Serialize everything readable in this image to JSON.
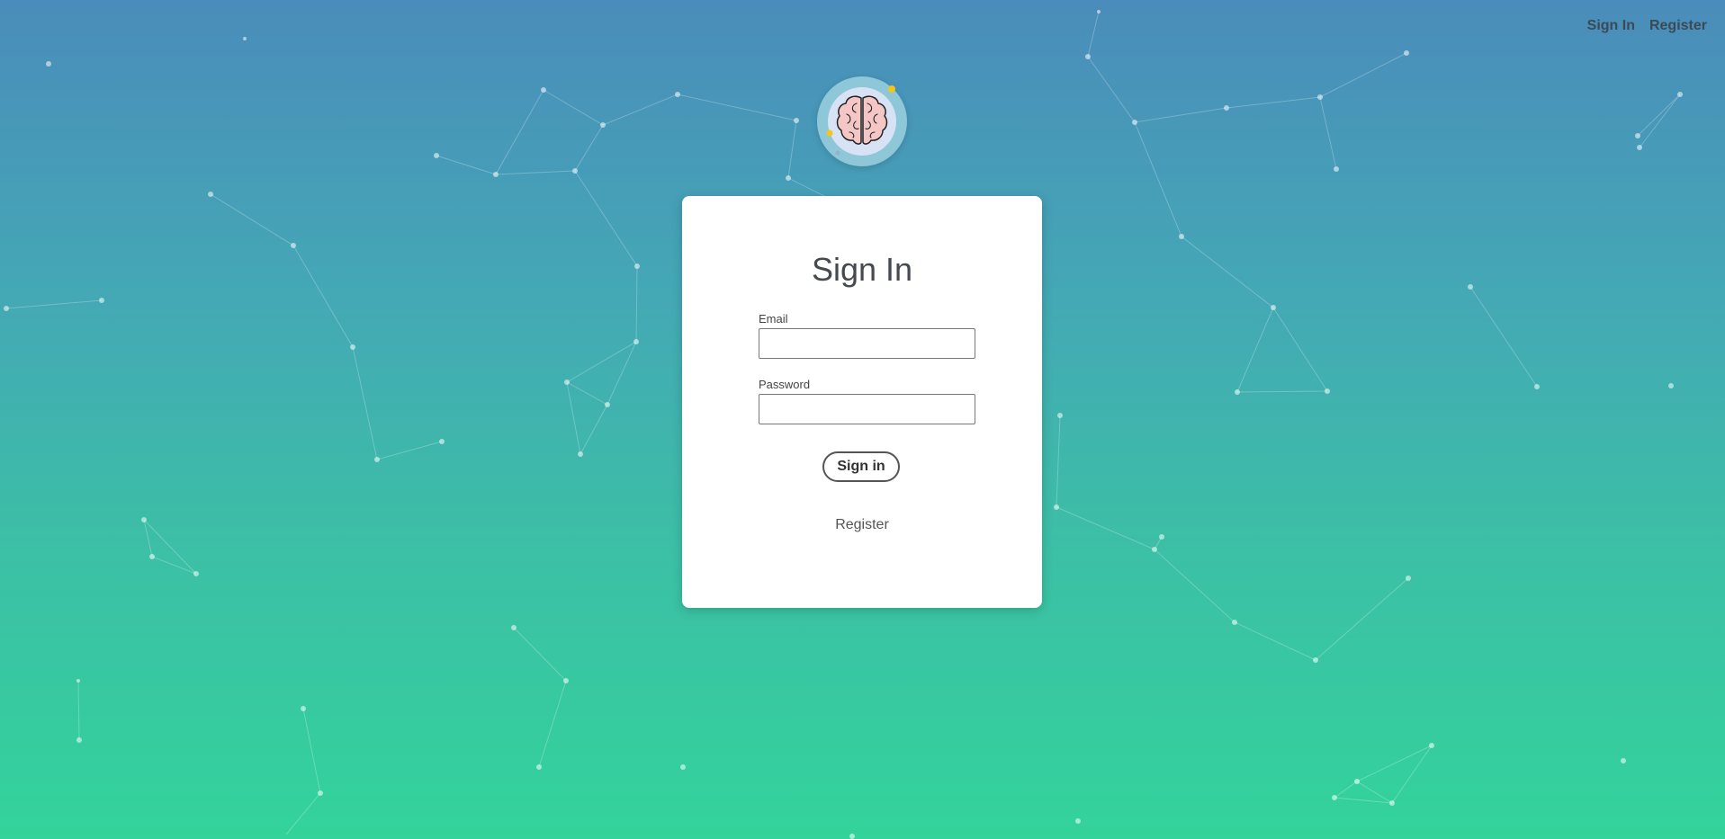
{
  "topnav": {
    "sign_in": "Sign In",
    "register": "Register"
  },
  "logo": {
    "icon": "brain-icon"
  },
  "form": {
    "title": "Sign In",
    "email_label": "Email",
    "email_value": "",
    "password_label": "Password",
    "password_value": "",
    "submit_label": "Sign in",
    "register_link": "Register"
  },
  "colors": {
    "gradient_top": "#4a8cbb",
    "gradient_bottom": "#33d39b",
    "card": "#ffffff",
    "text": "#444a50"
  }
}
